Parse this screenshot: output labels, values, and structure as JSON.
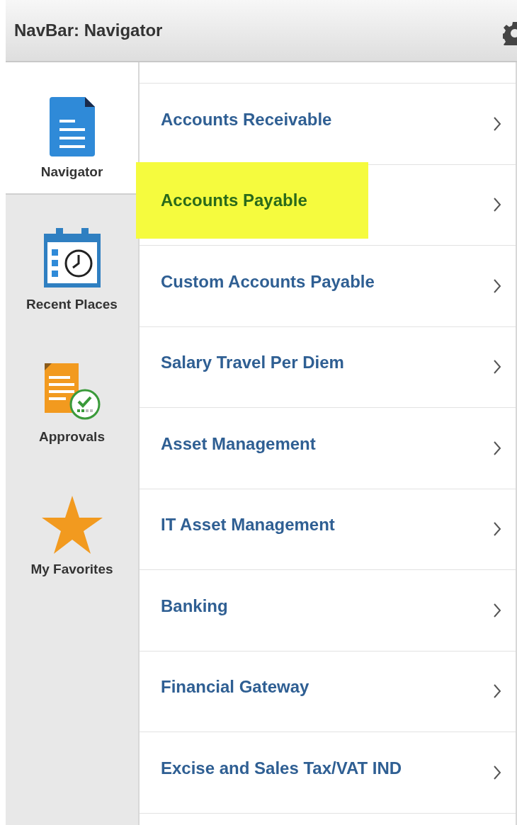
{
  "header": {
    "title": "NavBar: Navigator"
  },
  "sidebar": {
    "items": [
      {
        "label": "Navigator",
        "kind": "document",
        "selected": true
      },
      {
        "label": "Recent Places",
        "kind": "calendar",
        "selected": false
      },
      {
        "label": "Approvals",
        "kind": "approval",
        "selected": false
      },
      {
        "label": "My Favorites",
        "kind": "star",
        "selected": false
      }
    ]
  },
  "menu": {
    "items": [
      {
        "label": "Accounts Receivable",
        "highlighted": false
      },
      {
        "label": "Accounts Payable",
        "highlighted": true
      },
      {
        "label": "Custom Accounts Payable",
        "highlighted": false
      },
      {
        "label": "Salary Travel Per Diem",
        "highlighted": false
      },
      {
        "label": "Asset Management",
        "highlighted": false
      },
      {
        "label": "IT Asset Management",
        "highlighted": false
      },
      {
        "label": "Banking",
        "highlighted": false
      },
      {
        "label": "Financial Gateway",
        "highlighted": false
      },
      {
        "label": "Excise and Sales Tax/VAT IND",
        "highlighted": false
      }
    ]
  }
}
